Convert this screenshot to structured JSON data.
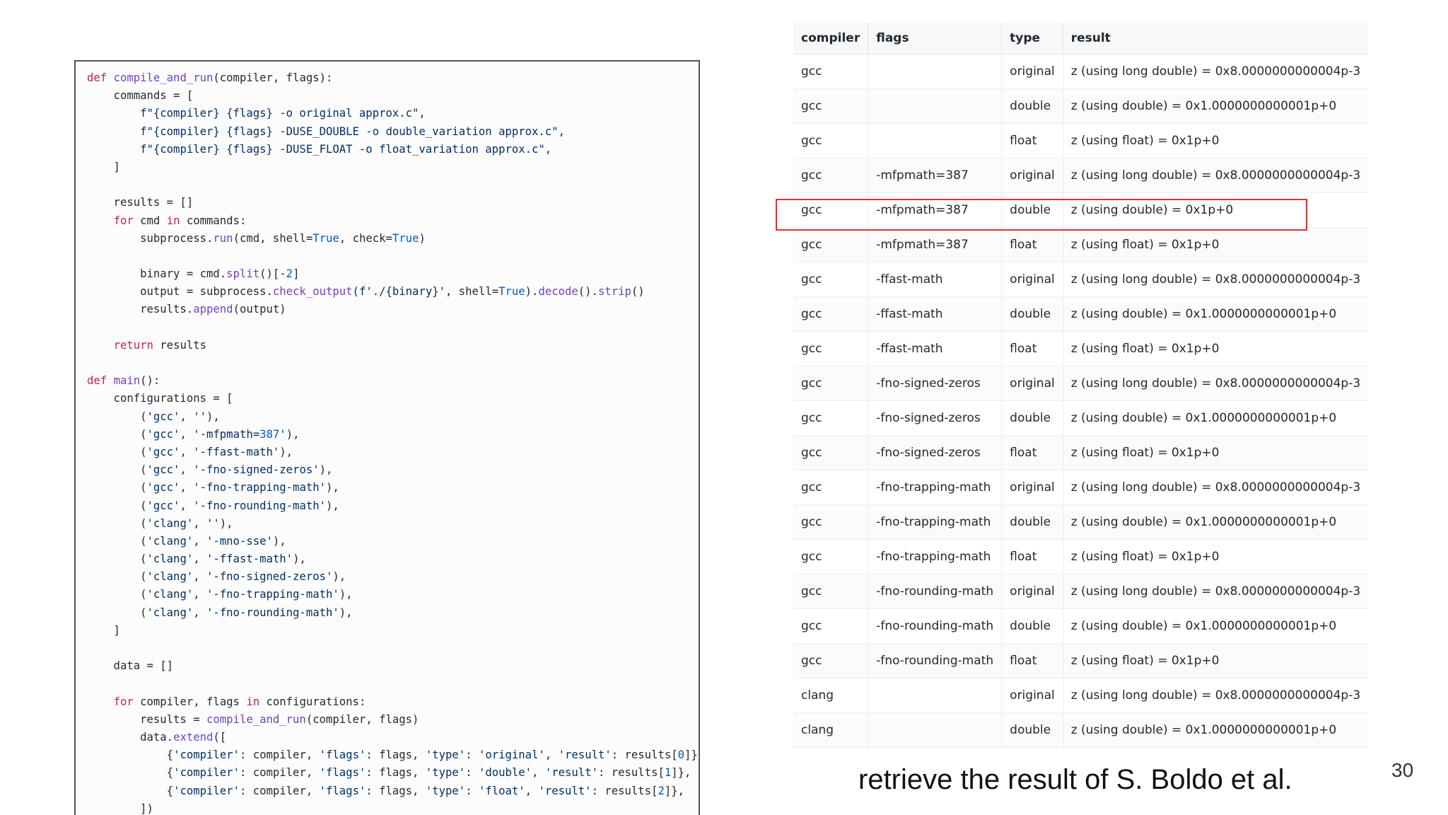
{
  "code": {
    "lines": [
      "def compile_and_run(compiler, flags):",
      "    commands = [",
      "        f\"{compiler} {flags} -o original approx.c\",",
      "        f\"{compiler} {flags} -DUSE_DOUBLE -o double_variation approx.c\",",
      "        f\"{compiler} {flags} -DUSE_FLOAT -o float_variation approx.c\",",
      "    ]",
      "",
      "    results = []",
      "    for cmd in commands:",
      "        subprocess.run(cmd, shell=True, check=True)",
      "",
      "        binary = cmd.split()[-2]",
      "        output = subprocess.check_output(f'./{binary}', shell=True).decode().strip()",
      "        results.append(output)",
      "",
      "    return results",
      "",
      "def main():",
      "    configurations = [",
      "        ('gcc', ''),",
      "        ('gcc', '-mfpmath=387'),",
      "        ('gcc', '-ffast-math'),",
      "        ('gcc', '-fno-signed-zeros'),",
      "        ('gcc', '-fno-trapping-math'),",
      "        ('gcc', '-fno-rounding-math'),",
      "        ('clang', ''),",
      "        ('clang', '-mno-sse'),",
      "        ('clang', '-ffast-math'),",
      "        ('clang', '-fno-signed-zeros'),",
      "        ('clang', '-fno-trapping-math'),",
      "        ('clang', '-fno-rounding-math'),",
      "    ]",
      "",
      "    data = []",
      "",
      "    for compiler, flags in configurations:",
      "        results = compile_and_run(compiler, flags)",
      "        data.extend([",
      "            {'compiler': compiler, 'flags': flags, 'type': 'original', 'result': results[0]},",
      "            {'compiler': compiler, 'flags': flags, 'type': 'double', 'result': results[1]},",
      "            {'compiler': compiler, 'flags': flags, 'type': 'float', 'result': results[2]},",
      "        ])"
    ]
  },
  "table": {
    "headers": [
      "compiler",
      "flags",
      "type",
      "result"
    ],
    "rows": [
      [
        "gcc",
        "",
        "original",
        "z (using long double) = 0x8.0000000000004p-3"
      ],
      [
        "gcc",
        "",
        "double",
        "z (using double) = 0x1.0000000000001p+0"
      ],
      [
        "gcc",
        "",
        "float",
        "z (using float) = 0x1p+0"
      ],
      [
        "gcc",
        "-mfpmath=387",
        "original",
        "z (using long double) = 0x8.0000000000004p-3"
      ],
      [
        "gcc",
        "-mfpmath=387",
        "double",
        "z (using double) = 0x1p+0"
      ],
      [
        "gcc",
        "-mfpmath=387",
        "float",
        "z (using float) = 0x1p+0"
      ],
      [
        "gcc",
        "-ffast-math",
        "original",
        "z (using long double) = 0x8.0000000000004p-3"
      ],
      [
        "gcc",
        "-ffast-math",
        "double",
        "z (using double) = 0x1.0000000000001p+0"
      ],
      [
        "gcc",
        "-ffast-math",
        "float",
        "z (using float) = 0x1p+0"
      ],
      [
        "gcc",
        "-fno-signed-zeros",
        "original",
        "z (using long double) = 0x8.0000000000004p-3"
      ],
      [
        "gcc",
        "-fno-signed-zeros",
        "double",
        "z (using double) = 0x1.0000000000001p+0"
      ],
      [
        "gcc",
        "-fno-signed-zeros",
        "float",
        "z (using float) = 0x1p+0"
      ],
      [
        "gcc",
        "-fno-trapping-math",
        "original",
        "z (using long double) = 0x8.0000000000004p-3"
      ],
      [
        "gcc",
        "-fno-trapping-math",
        "double",
        "z (using double) = 0x1.0000000000001p+0"
      ],
      [
        "gcc",
        "-fno-trapping-math",
        "float",
        "z (using float) = 0x1p+0"
      ],
      [
        "gcc",
        "-fno-rounding-math",
        "original",
        "z (using long double) = 0x8.0000000000004p-3"
      ],
      [
        "gcc",
        "-fno-rounding-math",
        "double",
        "z (using double) = 0x1.0000000000001p+0"
      ],
      [
        "gcc",
        "-fno-rounding-math",
        "float",
        "z (using float) = 0x1p+0"
      ],
      [
        "clang",
        "",
        "original",
        "z (using long double) = 0x8.0000000000004p-3"
      ],
      [
        "clang",
        "",
        "double",
        "z (using double) = 0x1.0000000000001p+0"
      ]
    ],
    "highlight_color": "#e03131"
  },
  "caption": "retrieve the result of S. Boldo et al.",
  "page_number": "30"
}
